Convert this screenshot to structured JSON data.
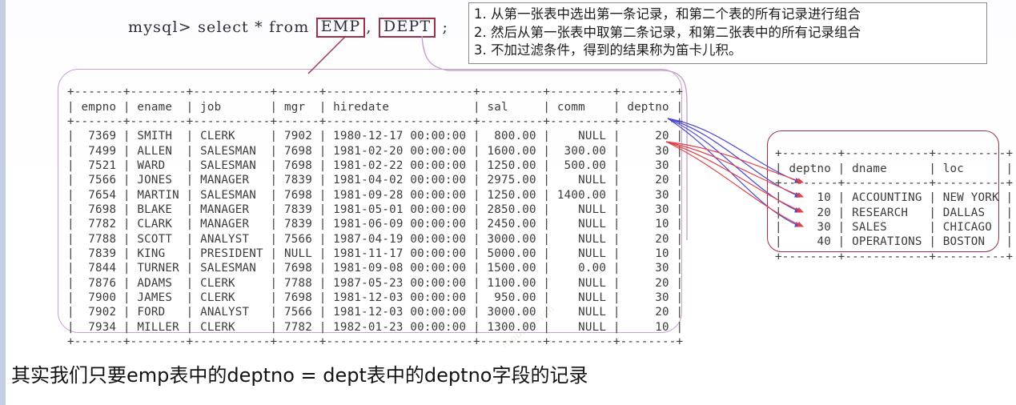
{
  "query": {
    "prefix": "mysql> select * from ",
    "table1": "EMP",
    "separator": ", ",
    "table2": "DEPT",
    "terminator": " ;"
  },
  "note_box": {
    "lines": [
      "1. 从第一张表中选出第一条记录，和第二个表的所有记录进行组合",
      "2. 然后从第一张表中取第二条记录，和第二张表中的所有记录组合",
      "3. 不加过滤条件，得到的结果称为笛卡儿积。"
    ]
  },
  "emp_table": {
    "name": "EMP",
    "columns": [
      "empno",
      "ename",
      "job",
      "mgr",
      "hiredate",
      "sal",
      "comm",
      "deptno"
    ],
    "rows": [
      [
        "7369",
        "SMITH",
        "CLERK",
        "7902",
        "1980-12-17 00:00:00",
        "800.00",
        "NULL",
        "20"
      ],
      [
        "7499",
        "ALLEN",
        "SALESMAN",
        "7698",
        "1981-02-20 00:00:00",
        "1600.00",
        "300.00",
        "30"
      ],
      [
        "7521",
        "WARD",
        "SALESMAN",
        "7698",
        "1981-02-22 00:00:00",
        "1250.00",
        "500.00",
        "30"
      ],
      [
        "7566",
        "JONES",
        "MANAGER",
        "7839",
        "1981-04-02 00:00:00",
        "2975.00",
        "NULL",
        "20"
      ],
      [
        "7654",
        "MARTIN",
        "SALESMAN",
        "7698",
        "1981-09-28 00:00:00",
        "1250.00",
        "1400.00",
        "30"
      ],
      [
        "7698",
        "BLAKE",
        "MANAGER",
        "7839",
        "1981-05-01 00:00:00",
        "2850.00",
        "NULL",
        "30"
      ],
      [
        "7782",
        "CLARK",
        "MANAGER",
        "7839",
        "1981-06-09 00:00:00",
        "2450.00",
        "NULL",
        "10"
      ],
      [
        "7788",
        "SCOTT",
        "ANALYST",
        "7566",
        "1987-04-19 00:00:00",
        "3000.00",
        "NULL",
        "20"
      ],
      [
        "7839",
        "KING",
        "PRESIDENT",
        "NULL",
        "1981-11-17 00:00:00",
        "5000.00",
        "NULL",
        "10"
      ],
      [
        "7844",
        "TURNER",
        "SALESMAN",
        "7698",
        "1981-09-08 00:00:00",
        "1500.00",
        "0.00",
        "30"
      ],
      [
        "7876",
        "ADAMS",
        "CLERK",
        "7788",
        "1987-05-23 00:00:00",
        "1100.00",
        "NULL",
        "20"
      ],
      [
        "7900",
        "JAMES",
        "CLERK",
        "7698",
        "1981-12-03 00:00:00",
        "950.00",
        "NULL",
        "30"
      ],
      [
        "7902",
        "FORD",
        "ANALYST",
        "7566",
        "1981-12-03 00:00:00",
        "3000.00",
        "NULL",
        "20"
      ],
      [
        "7934",
        "MILLER",
        "CLERK",
        "7782",
        "1982-01-23 00:00:00",
        "1300.00",
        "NULL",
        "10"
      ]
    ]
  },
  "dept_table": {
    "name": "DEPT",
    "columns": [
      "deptno",
      "dname",
      "loc"
    ],
    "rows": [
      [
        "10",
        "ACCOUNTING",
        "NEW YORK"
      ],
      [
        "20",
        "RESEARCH",
        "DALLAS"
      ],
      [
        "30",
        "SALES",
        "CHICAGO"
      ],
      [
        "40",
        "OPERATIONS",
        "BOSTON"
      ]
    ]
  },
  "caption": "其实我们只要emp表中的deptno = dept表中的deptno字段的记录",
  "watermark": "mooc.osych",
  "colors": {
    "highlight_box_border": "#9c3046",
    "emp_panel_border": "#c9a0d0",
    "dept_panel_border": "#9c3046",
    "arrow_blue": "#4a4ad0",
    "arrow_red": "#e2404a",
    "left_strip": "#c4cfe3",
    "note_border": "#8a8a8a"
  }
}
